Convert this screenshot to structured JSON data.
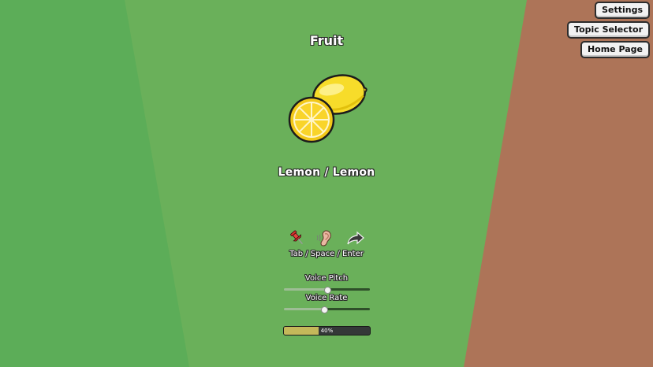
{
  "nav": {
    "settings": "Settings",
    "topic_selector": "Topic Selector",
    "home_page": "Home Page"
  },
  "topic": "Fruit",
  "word": "Lemon / Lemon",
  "controls": {
    "icons": [
      "pushpin-icon",
      "ear-icon",
      "share-arrow-icon"
    ],
    "hint": "Tab / Space / Enter"
  },
  "voice_pitch": {
    "label": "Voice Pitch",
    "value": 0.5
  },
  "voice_rate": {
    "label": "Voice Rate",
    "value": 0.47
  },
  "progress": {
    "value": 0.4,
    "label": "40%"
  },
  "colors": {
    "left_panel": "#5cad58",
    "center": "#6ab05a",
    "right_panel": "#ad7458",
    "progress_fill": "#c4b85a"
  }
}
